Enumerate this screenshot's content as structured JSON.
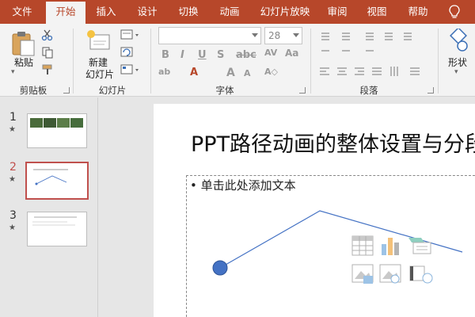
{
  "tabs": [
    {
      "label": "文件",
      "active": false
    },
    {
      "label": "开始",
      "active": true
    },
    {
      "label": "插入",
      "active": false
    },
    {
      "label": "设计",
      "active": false
    },
    {
      "label": "切换",
      "active": false
    },
    {
      "label": "动画",
      "active": false
    },
    {
      "label": "幻灯片放映",
      "active": false
    },
    {
      "label": "审阅",
      "active": false
    },
    {
      "label": "视图",
      "active": false
    },
    {
      "label": "帮助",
      "active": false
    }
  ],
  "ribbon": {
    "clipboard": {
      "paste_label": "粘贴",
      "group_label": "剪贴板"
    },
    "slides": {
      "new_slide_label_1": "新建",
      "new_slide_label_2": "幻灯片",
      "group_label": "幻灯片"
    },
    "font": {
      "font_name": "",
      "font_size": "28",
      "group_label": "字体"
    },
    "paragraph": {
      "group_label": "段落"
    },
    "drawing": {
      "shape_label": "形状"
    }
  },
  "thumbnails": [
    {
      "number": "1",
      "selected": false
    },
    {
      "number": "2",
      "selected": true
    },
    {
      "number": "3",
      "selected": false
    }
  ],
  "slide": {
    "title": "PPT路径动画的整体设置与分段",
    "content_placeholder": "• 单击此处添加文本"
  },
  "colors": {
    "accent": "#b7472a",
    "selection": "#c0504d",
    "path_line": "#4472c4",
    "motion_dot": "#4472c4"
  }
}
